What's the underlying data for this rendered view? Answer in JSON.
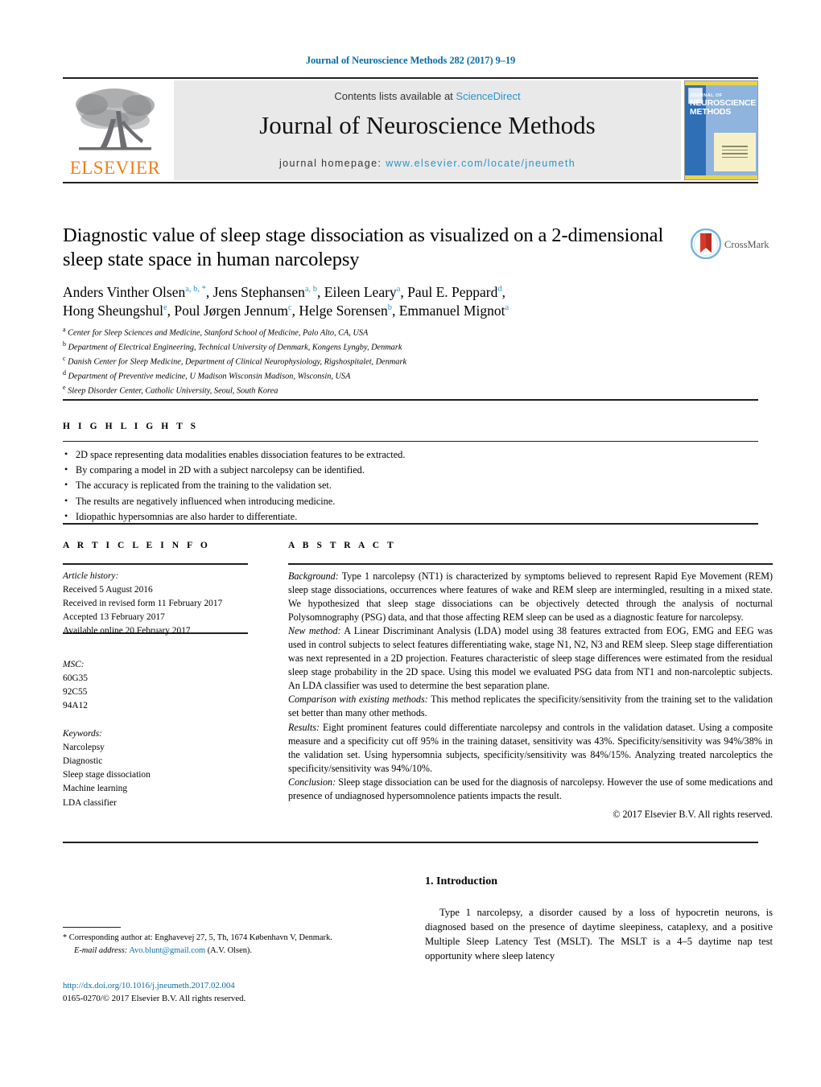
{
  "running_head": "Journal of Neuroscience Methods 282 (2017) 9–19",
  "masthead": {
    "contents_prefix": "Contents lists available at ",
    "sciencedirect": "ScienceDirect",
    "journal_title": "Journal of Neuroscience Methods",
    "homepage_prefix": "journal homepage: ",
    "homepage_url": "www.elsevier.com/locate/jneumeth",
    "publisher_logo_text": "ELSEVIER",
    "cover": {
      "line1": "JOURNAL OF",
      "line2": "NEUROSCIENCE",
      "line3": "METHODS"
    },
    "colors": {
      "link": "#2a93c9",
      "band": "#e9e9e9",
      "elsevier_orange": "#ef7f1a"
    }
  },
  "crossmark": {
    "label": "CrossMark"
  },
  "article": {
    "title": "Diagnostic value of sleep stage dissociation as visualized on a 2-dimensional sleep state space in human narcolepsy",
    "authors": [
      {
        "name": "Anders Vinther Olsen",
        "marks": "a, b, *"
      },
      {
        "name": "Jens Stephansen",
        "marks": "a, b"
      },
      {
        "name": "Eileen Leary",
        "marks": "a"
      },
      {
        "name": "Paul E. Peppard",
        "marks": "d"
      },
      {
        "name": "Hong Sheungshul",
        "marks": "e"
      },
      {
        "name": "Poul Jørgen Jennum",
        "marks": "c"
      },
      {
        "name": "Helge Sorensen",
        "marks": "b"
      },
      {
        "name": "Emmanuel Mignot",
        "marks": "a"
      }
    ],
    "affiliations": [
      {
        "mark": "a",
        "text": "Center for Sleep Sciences and Medicine, Stanford School of Medicine, Palo Alto, CA, USA"
      },
      {
        "mark": "b",
        "text": "Department of Electrical Engineering, Technical University of Denmark, Kongens Lyngby, Denmark"
      },
      {
        "mark": "c",
        "text": "Danish Center for Sleep Medicine, Department of Clinical Neurophysiology, Rigshospitalet, Denmark"
      },
      {
        "mark": "d",
        "text": "Department of Preventive medicine, U Madison Wisconsin Madison, Wisconsin, USA"
      },
      {
        "mark": "e",
        "text": "Sleep Disorder Center, Catholic University, Seoul, South Korea"
      }
    ]
  },
  "highlights": {
    "label": "H I G H L I G H T S",
    "items": [
      "2D space representing data modalities enables dissociation features to be extracted.",
      "By comparing a model in 2D with a subject narcolepsy can be identified.",
      "The accuracy is replicated from the training to the validation set.",
      "The results are negatively influenced when introducing medicine.",
      "Idiopathic hypersomnias are also harder to differentiate."
    ]
  },
  "article_info": {
    "label": "A R T I C L E    I N F O",
    "history_heading": "Article history:",
    "history": [
      "Received 5 August 2016",
      "Received in revised form 11 February 2017",
      "Accepted 13 February 2017",
      "Available online 20 February 2017"
    ],
    "msc_heading": "MSC:",
    "msc": [
      "60G35",
      "92C55",
      "94A12"
    ],
    "keywords_heading": "Keywords:",
    "keywords": [
      "Narcolepsy",
      "Diagnostic",
      "Sleep stage dissociation",
      "Machine learning",
      "LDA classifier"
    ]
  },
  "abstract": {
    "label": "A B S T R A C T",
    "sections": [
      {
        "lead": "Background:",
        "text": " Type 1 narcolepsy (NT1) is characterized by symptoms believed to represent Rapid Eye Movement (REM) sleep stage dissociations, occurrences where features of wake and REM sleep are intermingled, resulting in a mixed state. We hypothesized that sleep stage dissociations can be objectively detected through the analysis of nocturnal Polysomnography (PSG) data, and that those affecting REM sleep can be used as a diagnostic feature for narcolepsy."
      },
      {
        "lead": "New method:",
        "text": " A Linear Discriminant Analysis (LDA) model using 38 features extracted from EOG, EMG and EEG was used in control subjects to select features differentiating wake, stage N1, N2, N3 and REM sleep. Sleep stage differentiation was next represented in a 2D projection. Features characteristic of sleep stage differences were estimated from the residual sleep stage probability in the 2D space. Using this model we evaluated PSG data from NT1 and non-narcoleptic subjects. An LDA classifier was used to determine the best separation plane."
      },
      {
        "lead": "Comparison with existing methods:",
        "text": " This method replicates the specificity/sensitivity from the training set to the validation set better than many other methods."
      },
      {
        "lead": "Results:",
        "text": " Eight prominent features could differentiate narcolepsy and controls in the validation dataset. Using a composite measure and a specificity cut off 95% in the training dataset, sensitivity was 43%. Specificity/sensitivity was 94%/38% in the validation set. Using hypersomnia subjects, specificity/sensitivity was 84%/15%. Analyzing treated narcoleptics the specificity/sensitivity was 94%/10%."
      },
      {
        "lead": "Conclusion:",
        "text": " Sleep stage dissociation can be used for the diagnosis of narcolepsy. However the use of some medications and presence of undiagnosed hypersomnolence patients impacts the result."
      }
    ],
    "copyright": "© 2017 Elsevier B.V. All rights reserved."
  },
  "introduction": {
    "heading": "1.  Introduction",
    "paragraph": "Type 1 narcolepsy, a disorder caused by a loss of hypocretin neurons, is diagnosed based on the presence of daytime sleepiness, cataplexy, and a positive Multiple Sleep Latency Test (MSLT). The MSLT is a 4–5 daytime nap test opportunity where sleep latency"
  },
  "footnote": {
    "star": "*",
    "corresponding": " Corresponding author at: Enghavevej 27, 5, Th, 1674 København V, Denmark.",
    "email_label": "E-mail address:",
    "email": "Avo.blunt@gmail.com",
    "email_owner": " (A.V. Olsen)."
  },
  "footer": {
    "doi": "http://dx.doi.org/10.1016/j.jneumeth.2017.02.004",
    "issn_line": "0165-0270/© 2017 Elsevier B.V. All rights reserved."
  }
}
